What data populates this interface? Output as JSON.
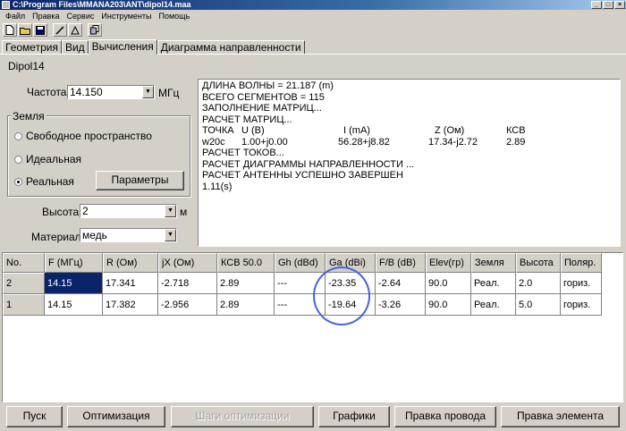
{
  "window": {
    "title": "C:\\Program Files\\MMANA203\\ANT\\dipol14.maa",
    "min": "_",
    "max": "□",
    "close": "×"
  },
  "menu": [
    "Файл",
    "Правка",
    "Сервис",
    "Инструменты",
    "Помощь"
  ],
  "toolbar": {
    "icons": [
      "new-icon",
      "open-icon",
      "save-icon",
      "wire-icon",
      "triangle-icon",
      "copy-icon"
    ]
  },
  "tabs": [
    "Геометрия",
    "Вид",
    "Вычисления",
    "Диаграмма направленности"
  ],
  "antenna_name": "Dipol14",
  "frequency": {
    "label": "Частота",
    "value": "14.150",
    "unit": "МГц"
  },
  "ground": {
    "title": "Земля",
    "options": [
      "Свободное пространство",
      "Идеальная",
      "Реальная"
    ],
    "selected": 2,
    "params_button": "Параметры"
  },
  "height": {
    "label": "Высота",
    "value": "2",
    "unit": "м"
  },
  "material": {
    "label": "Материал",
    "value": "медь"
  },
  "output": {
    "lines": [
      "ДЛИНА ВОЛНЫ = 21.187 (m)",
      "ВСЕГО СЕГМЕНТОВ = 115",
      "ЗАПОЛНЕНИЕ МАТРИЦ...",
      "РАСЧЕТ МАТРИЦ...",
      [
        "ТОЧКА",
        "U (B)",
        "I (mA)",
        "Z (Ом)",
        "КСВ"
      ],
      [
        "w20c",
        "1.00+j0.00",
        "56.28+j8.82",
        "17.34-j2.72",
        "2.89"
      ],
      "РАСЧЕТ ТОКОВ...",
      "РАСЧЕТ ДИАГРАММЫ НАПРАВЛЕННОСТИ ...",
      "РАСЧЕТ АНТЕННЫ УСПЕШНО ЗАВЕРШЕН",
      "1.11(s)"
    ]
  },
  "table": {
    "columns": [
      "No.",
      "F (МГц)",
      "R (Ом)",
      "jX (Ом)",
      "КСВ 50.0",
      "Gh (dBd)",
      "Ga (dBi)",
      "F/B (dB)",
      "Elev(гр)",
      "Земля",
      "Высота",
      "Поляр."
    ],
    "rows": [
      [
        "2",
        "14.15",
        "17.341",
        "-2.718",
        "2.89",
        "---",
        "-23.35",
        "-2.64",
        "90.0",
        "Реал.",
        "2.0",
        "гориз."
      ],
      [
        "1",
        "14.15",
        "17.382",
        "-2.956",
        "2.89",
        "---",
        "-19.64",
        "-3.26",
        "90.0",
        "Реал.",
        "5.0",
        "гориз."
      ]
    ]
  },
  "buttons": {
    "start": "Пуск",
    "optimize": "Оптимизация",
    "opt_steps": "Шаги оптимизации",
    "graphs": "Графики",
    "edit_wire": "Правка провода",
    "edit_element": "Правка элемента"
  },
  "colors": {
    "title_bar": "#0a246a",
    "selection": "#0a246a",
    "highlight_circle": "#4466dd"
  }
}
